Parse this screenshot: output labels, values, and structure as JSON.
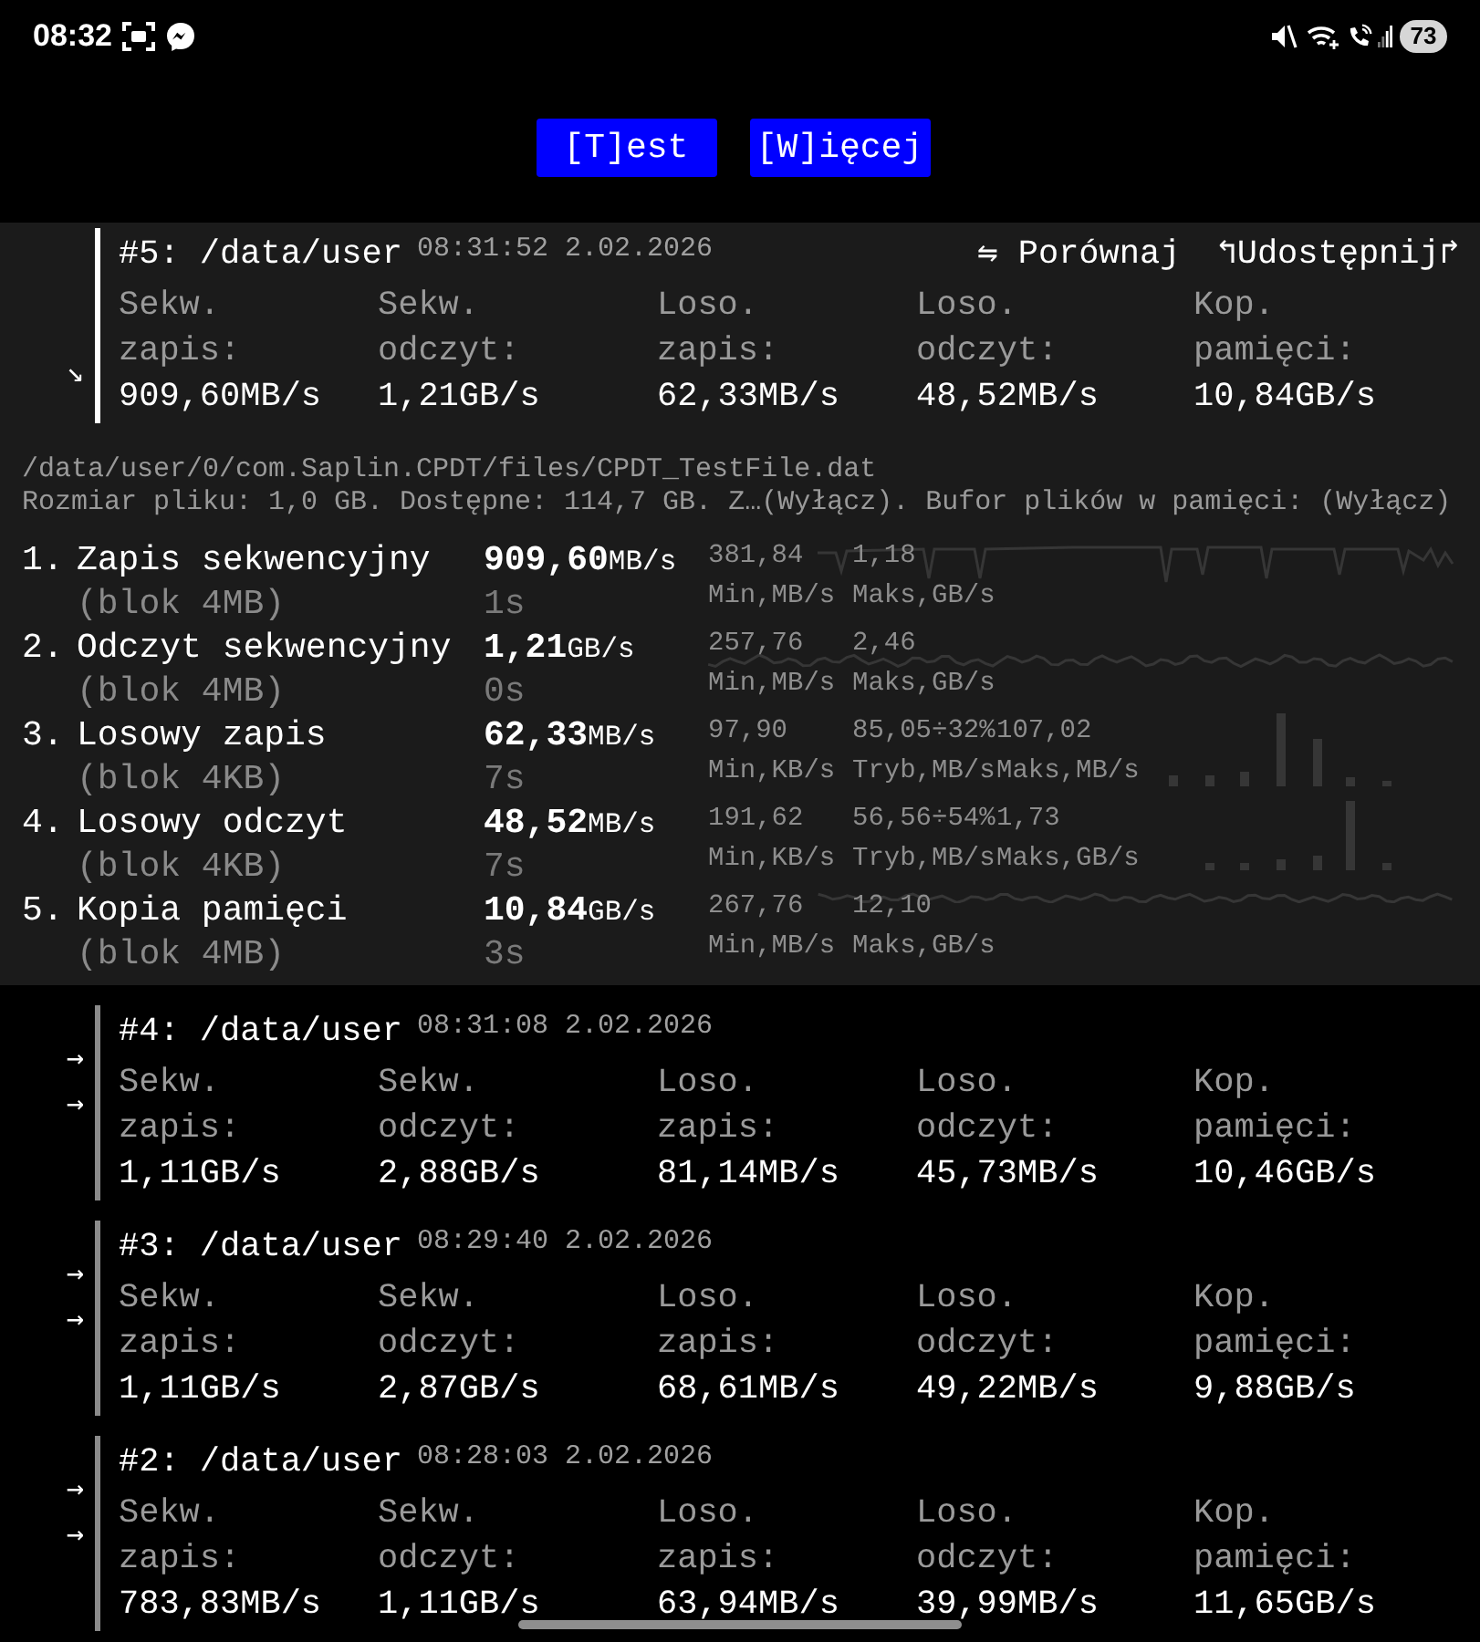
{
  "status_bar": {
    "time": "08:32",
    "battery": "73"
  },
  "toolbar": {
    "buttons": [
      {
        "label": "[T]est"
      },
      {
        "label": "[W]ięcej"
      }
    ]
  },
  "results": [
    {
      "title": "#5: /data/user",
      "timestamp": "08:31:52 2.02.2026",
      "expanded": true,
      "markers": [
        "↘"
      ],
      "actions": [
        {
          "label": "⇋ Porównaj"
        },
        {
          "label": "↰Udostępnij↱"
        }
      ],
      "metrics": [
        {
          "label": "Sekw. zapis:",
          "value": "909,60MB/s"
        },
        {
          "label": "Sekw. odczyt:",
          "value": "1,21GB/s"
        },
        {
          "label": "Loso. zapis:",
          "value": "62,33MB/s"
        },
        {
          "label": "Loso. odczyt:",
          "value": "48,52MB/s"
        },
        {
          "label": "Kop. pamięci:",
          "value": "10,84GB/s"
        }
      ],
      "details": {
        "file_path": "/data/user/0/com.Saplin.CPDT/files/CPDT_TestFile.dat",
        "info": "Rozmiar pliku: 1,0 GB. Dostępne: 114,7 GB. Z…(Wyłącz). Bufor plików w pamięci: (Wyłącz)"
      },
      "tests": [
        {
          "kind": "line",
          "number": "1.",
          "name": "Zapis sekwencyjny",
          "block": "(blok 4MB)",
          "value": "909,60",
          "unit": "MB/s",
          "duration": "1s",
          "stats": [
            {
              "value": "381,84",
              "label": "Min,MB/s"
            },
            {
              "value": "1,18",
              "label": "Maks,GB/s"
            }
          ]
        },
        {
          "kind": "line",
          "number": "2.",
          "name": "Odczyt sekwencyjny",
          "block": "(blok 4MB)",
          "value": "1,21",
          "unit": "GB/s",
          "duration": "0s",
          "stats": [
            {
              "value": "257,76",
              "label": "Min,MB/s"
            },
            {
              "value": "2,46",
              "label": "Maks,GB/s"
            }
          ]
        },
        {
          "kind": "bars",
          "number": "3.",
          "name": "Losowy zapis",
          "block": "(blok 4KB)",
          "value": "62,33",
          "unit": "MB/s",
          "duration": "7s",
          "stats": [
            {
              "value": "97,90",
              "label": "Min,KB/s"
            },
            {
              "value": "85,05÷32%",
              "label": "Tryb,MB/s"
            },
            {
              "value": "107,02",
              "label": "Maks,MB/s"
            }
          ]
        },
        {
          "kind": "bars",
          "number": "4.",
          "name": "Losowy odczyt",
          "block": "(blok 4KB)",
          "value": "48,52",
          "unit": "MB/s",
          "duration": "7s",
          "stats": [
            {
              "value": "191,62",
              "label": "Min,KB/s"
            },
            {
              "value": "56,56÷54%",
              "label": "Tryb,MB/s"
            },
            {
              "value": "1,73",
              "label": "Maks,GB/s"
            }
          ]
        },
        {
          "kind": "line",
          "number": "5.",
          "name": "Kopia pamięci",
          "block": "(blok 4MB)",
          "value": "10,84",
          "unit": "GB/s",
          "duration": "3s",
          "stats": [
            {
              "value": "267,76",
              "label": "Min,MB/s"
            },
            {
              "value": "12,10",
              "label": "Maks,GB/s"
            }
          ]
        }
      ]
    },
    {
      "title": "#4: /data/user",
      "timestamp": "08:31:08 2.02.2026",
      "expanded": false,
      "markers": [
        "→",
        "→"
      ],
      "metrics": [
        {
          "label": "Sekw. zapis:",
          "value": "1,11GB/s"
        },
        {
          "label": "Sekw. odczyt:",
          "value": "2,88GB/s"
        },
        {
          "label": "Loso. zapis:",
          "value": "81,14MB/s"
        },
        {
          "label": "Loso. odczyt:",
          "value": "45,73MB/s"
        },
        {
          "label": "Kop. pamięci:",
          "value": "10,46GB/s"
        }
      ]
    },
    {
      "title": "#3: /data/user",
      "timestamp": "08:29:40 2.02.2026",
      "expanded": false,
      "markers": [
        "→",
        "→"
      ],
      "metrics": [
        {
          "label": "Sekw. zapis:",
          "value": "1,11GB/s"
        },
        {
          "label": "Sekw. odczyt:",
          "value": "2,87GB/s"
        },
        {
          "label": "Loso. zapis:",
          "value": "68,61MB/s"
        },
        {
          "label": "Loso. odczyt:",
          "value": "49,22MB/s"
        },
        {
          "label": "Kop. pamięci:",
          "value": "9,88GB/s"
        }
      ]
    },
    {
      "title": "#2: /data/user",
      "timestamp": "08:28:03 2.02.2026",
      "expanded": false,
      "markers": [
        "→",
        "→"
      ],
      "metrics": [
        {
          "label": "Sekw. zapis:",
          "value": "783,83MB/s"
        },
        {
          "label": "Sekw. odczyt:",
          "value": "1,11GB/s"
        },
        {
          "label": "Loso. zapis:",
          "value": "63,94MB/s"
        },
        {
          "label": "Loso. odczyt:",
          "value": "39,99MB/s"
        },
        {
          "label": "Kop. pamięci:",
          "value": "11,65GB/s"
        }
      ]
    }
  ]
}
